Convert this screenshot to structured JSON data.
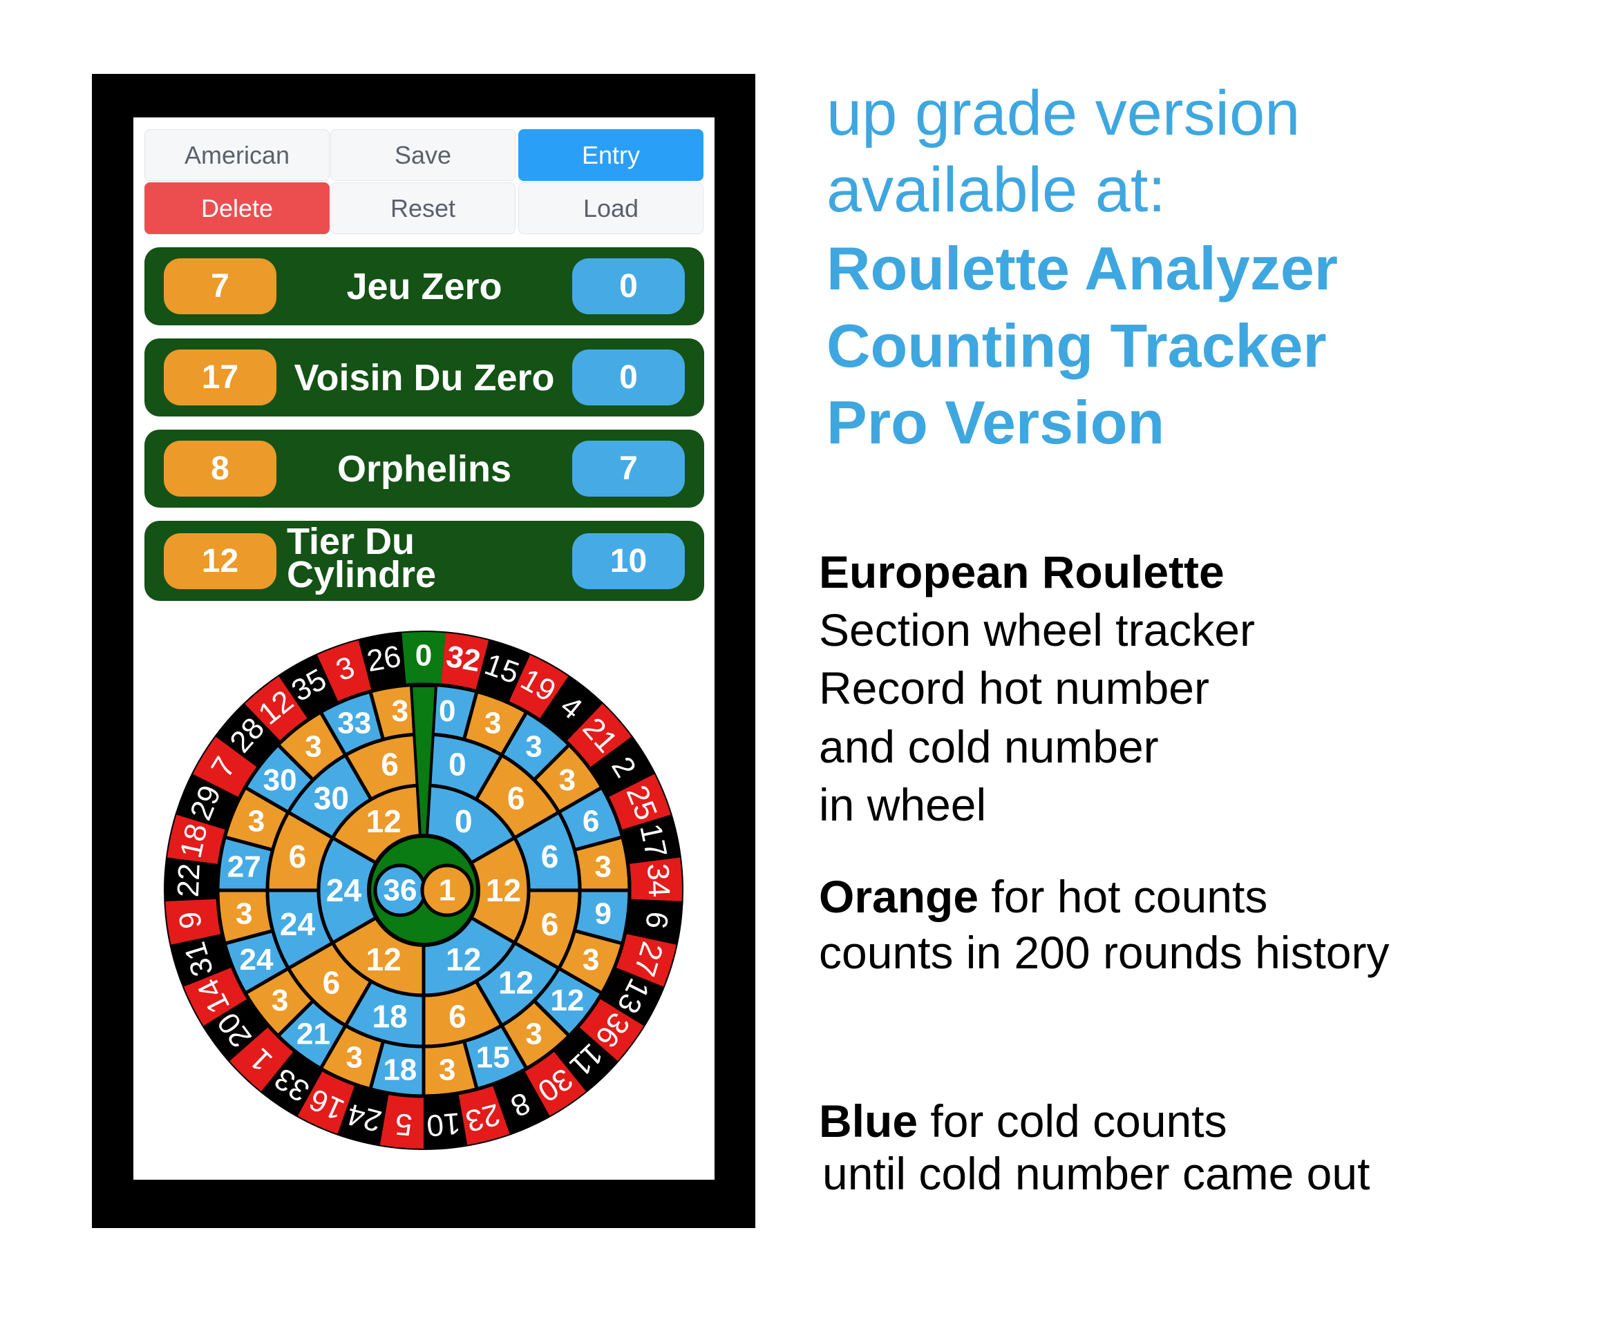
{
  "toolbar": {
    "american": "American",
    "save": "Save",
    "entry": "Entry",
    "delete": "Delete",
    "reset": "Reset",
    "load": "Load"
  },
  "sectors": [
    {
      "name": "Jeu Zero",
      "hot": "7",
      "cold": "0"
    },
    {
      "name": "Voisin Du Zero",
      "hot": "17",
      "cold": "0"
    },
    {
      "name": "Orphelins",
      "hot": "8",
      "cold": "7"
    },
    {
      "name": "Tier Du Cylindre",
      "hot": "12",
      "cold": "10"
    }
  ],
  "wheel": {
    "numbers": [
      0,
      32,
      15,
      19,
      4,
      21,
      2,
      25,
      17,
      34,
      6,
      27,
      13,
      36,
      11,
      30,
      8,
      23,
      10,
      5,
      24,
      16,
      33,
      1,
      20,
      14,
      31,
      9,
      22,
      18,
      29,
      7,
      28,
      12,
      35,
      3,
      26
    ],
    "red_numbers": [
      32,
      19,
      21,
      25,
      34,
      27,
      36,
      30,
      23,
      5,
      16,
      1,
      14,
      9,
      18,
      7,
      12,
      3
    ],
    "ring_outer": [
      {
        "v": "0",
        "c": "cold"
      },
      {
        "v": "3",
        "c": "hot"
      },
      {
        "v": "3",
        "c": "cold"
      },
      {
        "v": "3",
        "c": "hot"
      },
      {
        "v": "6",
        "c": "cold"
      },
      {
        "v": "3",
        "c": "hot"
      },
      {
        "v": "9",
        "c": "cold"
      },
      {
        "v": "3",
        "c": "hot"
      },
      {
        "v": "12",
        "c": "cold"
      },
      {
        "v": "3",
        "c": "hot"
      },
      {
        "v": "15",
        "c": "cold"
      },
      {
        "v": "3",
        "c": "hot"
      },
      {
        "v": "18",
        "c": "cold"
      },
      {
        "v": "3",
        "c": "hot"
      },
      {
        "v": "21",
        "c": "cold"
      },
      {
        "v": "3",
        "c": "hot"
      },
      {
        "v": "24",
        "c": "cold"
      },
      {
        "v": "3",
        "c": "hot"
      },
      {
        "v": "27",
        "c": "cold"
      },
      {
        "v": "3",
        "c": "hot"
      },
      {
        "v": "30",
        "c": "cold"
      },
      {
        "v": "3",
        "c": "hot"
      },
      {
        "v": "33",
        "c": "cold"
      },
      {
        "v": "3",
        "c": "hot"
      }
    ],
    "ring_middle": [
      {
        "v": "0",
        "c": "cold"
      },
      {
        "v": "6",
        "c": "hot"
      },
      {
        "v": "6",
        "c": "cold"
      },
      {
        "v": "6",
        "c": "hot"
      },
      {
        "v": "12",
        "c": "cold"
      },
      {
        "v": "6",
        "c": "hot"
      },
      {
        "v": "18",
        "c": "cold"
      },
      {
        "v": "6",
        "c": "hot"
      },
      {
        "v": "24",
        "c": "cold"
      },
      {
        "v": "6",
        "c": "hot"
      },
      {
        "v": "30",
        "c": "cold"
      },
      {
        "v": "6",
        "c": "hot"
      }
    ],
    "ring_inner": [
      {
        "v": "0",
        "c": "cold"
      },
      {
        "v": "12",
        "c": "hot"
      },
      {
        "v": "12",
        "c": "cold"
      },
      {
        "v": "12",
        "c": "hot"
      },
      {
        "v": "24",
        "c": "cold"
      },
      {
        "v": "12",
        "c": "hot"
      }
    ],
    "center_cold": "36",
    "center_hot": "1",
    "colors": {
      "hot": "#ec9a2a",
      "cold": "#46abe4",
      "green": "#0a7a12",
      "red": "#e31b1b",
      "black": "#000000"
    }
  },
  "promo": {
    "line1": "up grade version",
    "line2": "available at:",
    "line3": "Roulette Analyzer",
    "line4": "Counting Tracker",
    "line5": "Pro Version"
  },
  "description": {
    "title": "European Roulette",
    "l1": "Section wheel tracker",
    "l2": "Record hot number",
    "l3": "and cold number",
    "l4": "in wheel",
    "orange_word": "Orange",
    "orange_rest": " for hot counts",
    "orange_l2": "counts in 200 rounds history",
    "blue_word": "Blue",
    "blue_rest": " for cold counts",
    "blue_l2": "until cold number came out"
  }
}
